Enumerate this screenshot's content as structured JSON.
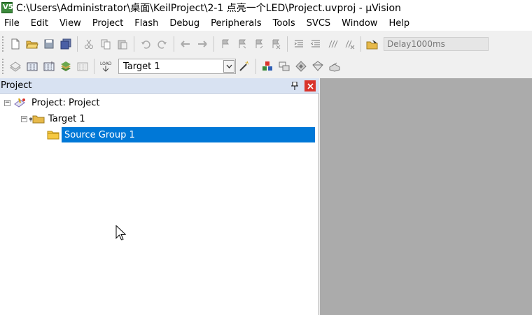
{
  "window": {
    "title": "C:\\Users\\Administrator\\桌面\\KeilProject\\2-1 点亮一个LED\\Project.uvproj - µVision",
    "app_icon_text": "V5"
  },
  "menu": [
    "File",
    "Edit",
    "View",
    "Project",
    "Flash",
    "Debug",
    "Peripherals",
    "Tools",
    "SVCS",
    "Window",
    "Help"
  ],
  "toolbar1": {
    "icons": [
      "new-file-icon",
      "open-folder-icon",
      "save-icon",
      "save-all-icon",
      "cut-icon",
      "copy-icon",
      "paste-icon",
      "undo-icon",
      "redo-icon",
      "navigate-back-icon",
      "navigate-forward-icon",
      "bookmark-icon",
      "prev-bookmark-icon",
      "next-bookmark-icon",
      "clear-bookmarks-icon",
      "indent-icon",
      "unindent-icon",
      "comment-icon",
      "uncomment-icon",
      "find-in-files-icon"
    ],
    "find_combo_value": "Delay1000ms"
  },
  "toolbar2": {
    "icons": [
      "translate-icon",
      "build-icon",
      "rebuild-icon",
      "batch-build-icon",
      "stop-build-icon",
      "download-icon",
      "target-options-icon",
      "manage-components-icon",
      "project-items-icon",
      "select-packs-icon",
      "manage-pack-icon",
      "pack-installer-icon"
    ],
    "load_text": "LOAD",
    "target_value": "Target 1"
  },
  "project_panel": {
    "title": "Project",
    "tree": [
      {
        "label": "Project: Project",
        "expanded": true
      },
      {
        "label": "Target 1",
        "expanded": true
      },
      {
        "label": "Source Group 1",
        "selected": true
      }
    ]
  },
  "colors": {
    "selection": "#0078d7",
    "panel_header": "#d8e2f2",
    "workspace": "#ababab",
    "close_button": "#d9332b"
  }
}
